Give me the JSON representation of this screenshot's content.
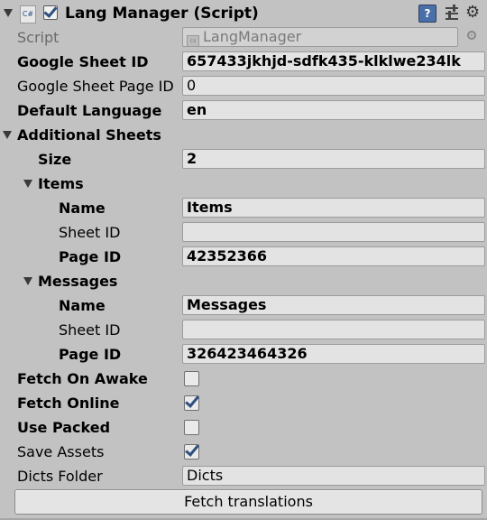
{
  "header": {
    "title": "Lang Manager (Script)",
    "script_icon_text": "C#",
    "enabled": true,
    "icons": [
      "help-icon",
      "preset-icon",
      "gear-icon"
    ]
  },
  "script": {
    "label": "Script",
    "value": "LangManager",
    "icon_text": "cs"
  },
  "google_sheet_id": {
    "label": "Google Sheet ID",
    "value": "657433jkhjd-sdfk435-klklwe234lk"
  },
  "google_sheet_page_id": {
    "label": "Google Sheet Page ID",
    "value": "0"
  },
  "default_language": {
    "label": "Default Language",
    "value": "en"
  },
  "additional_sheets": {
    "label": "Additional Sheets",
    "size_label": "Size",
    "size_value": "2",
    "elements": [
      {
        "label": "Items",
        "name_label": "Name",
        "name_value": "Items",
        "sheet_label": "Sheet ID",
        "sheet_value": "",
        "page_label": "Page ID",
        "page_value": "42352366"
      },
      {
        "label": "Messages",
        "name_label": "Name",
        "name_value": "Messages",
        "sheet_label": "Sheet ID",
        "sheet_value": "",
        "page_label": "Page ID",
        "page_value": "326423464326"
      }
    ]
  },
  "fetch_on_awake": {
    "label": "Fetch On Awake",
    "checked": false
  },
  "fetch_online": {
    "label": "Fetch Online",
    "checked": true
  },
  "use_packed": {
    "label": "Use Packed",
    "checked": false
  },
  "save_assets": {
    "label": "Save Assets",
    "checked": true
  },
  "dicts_folder": {
    "label": "Dicts Folder",
    "value": "Dicts"
  },
  "fetch_button": {
    "label": "Fetch translations"
  }
}
